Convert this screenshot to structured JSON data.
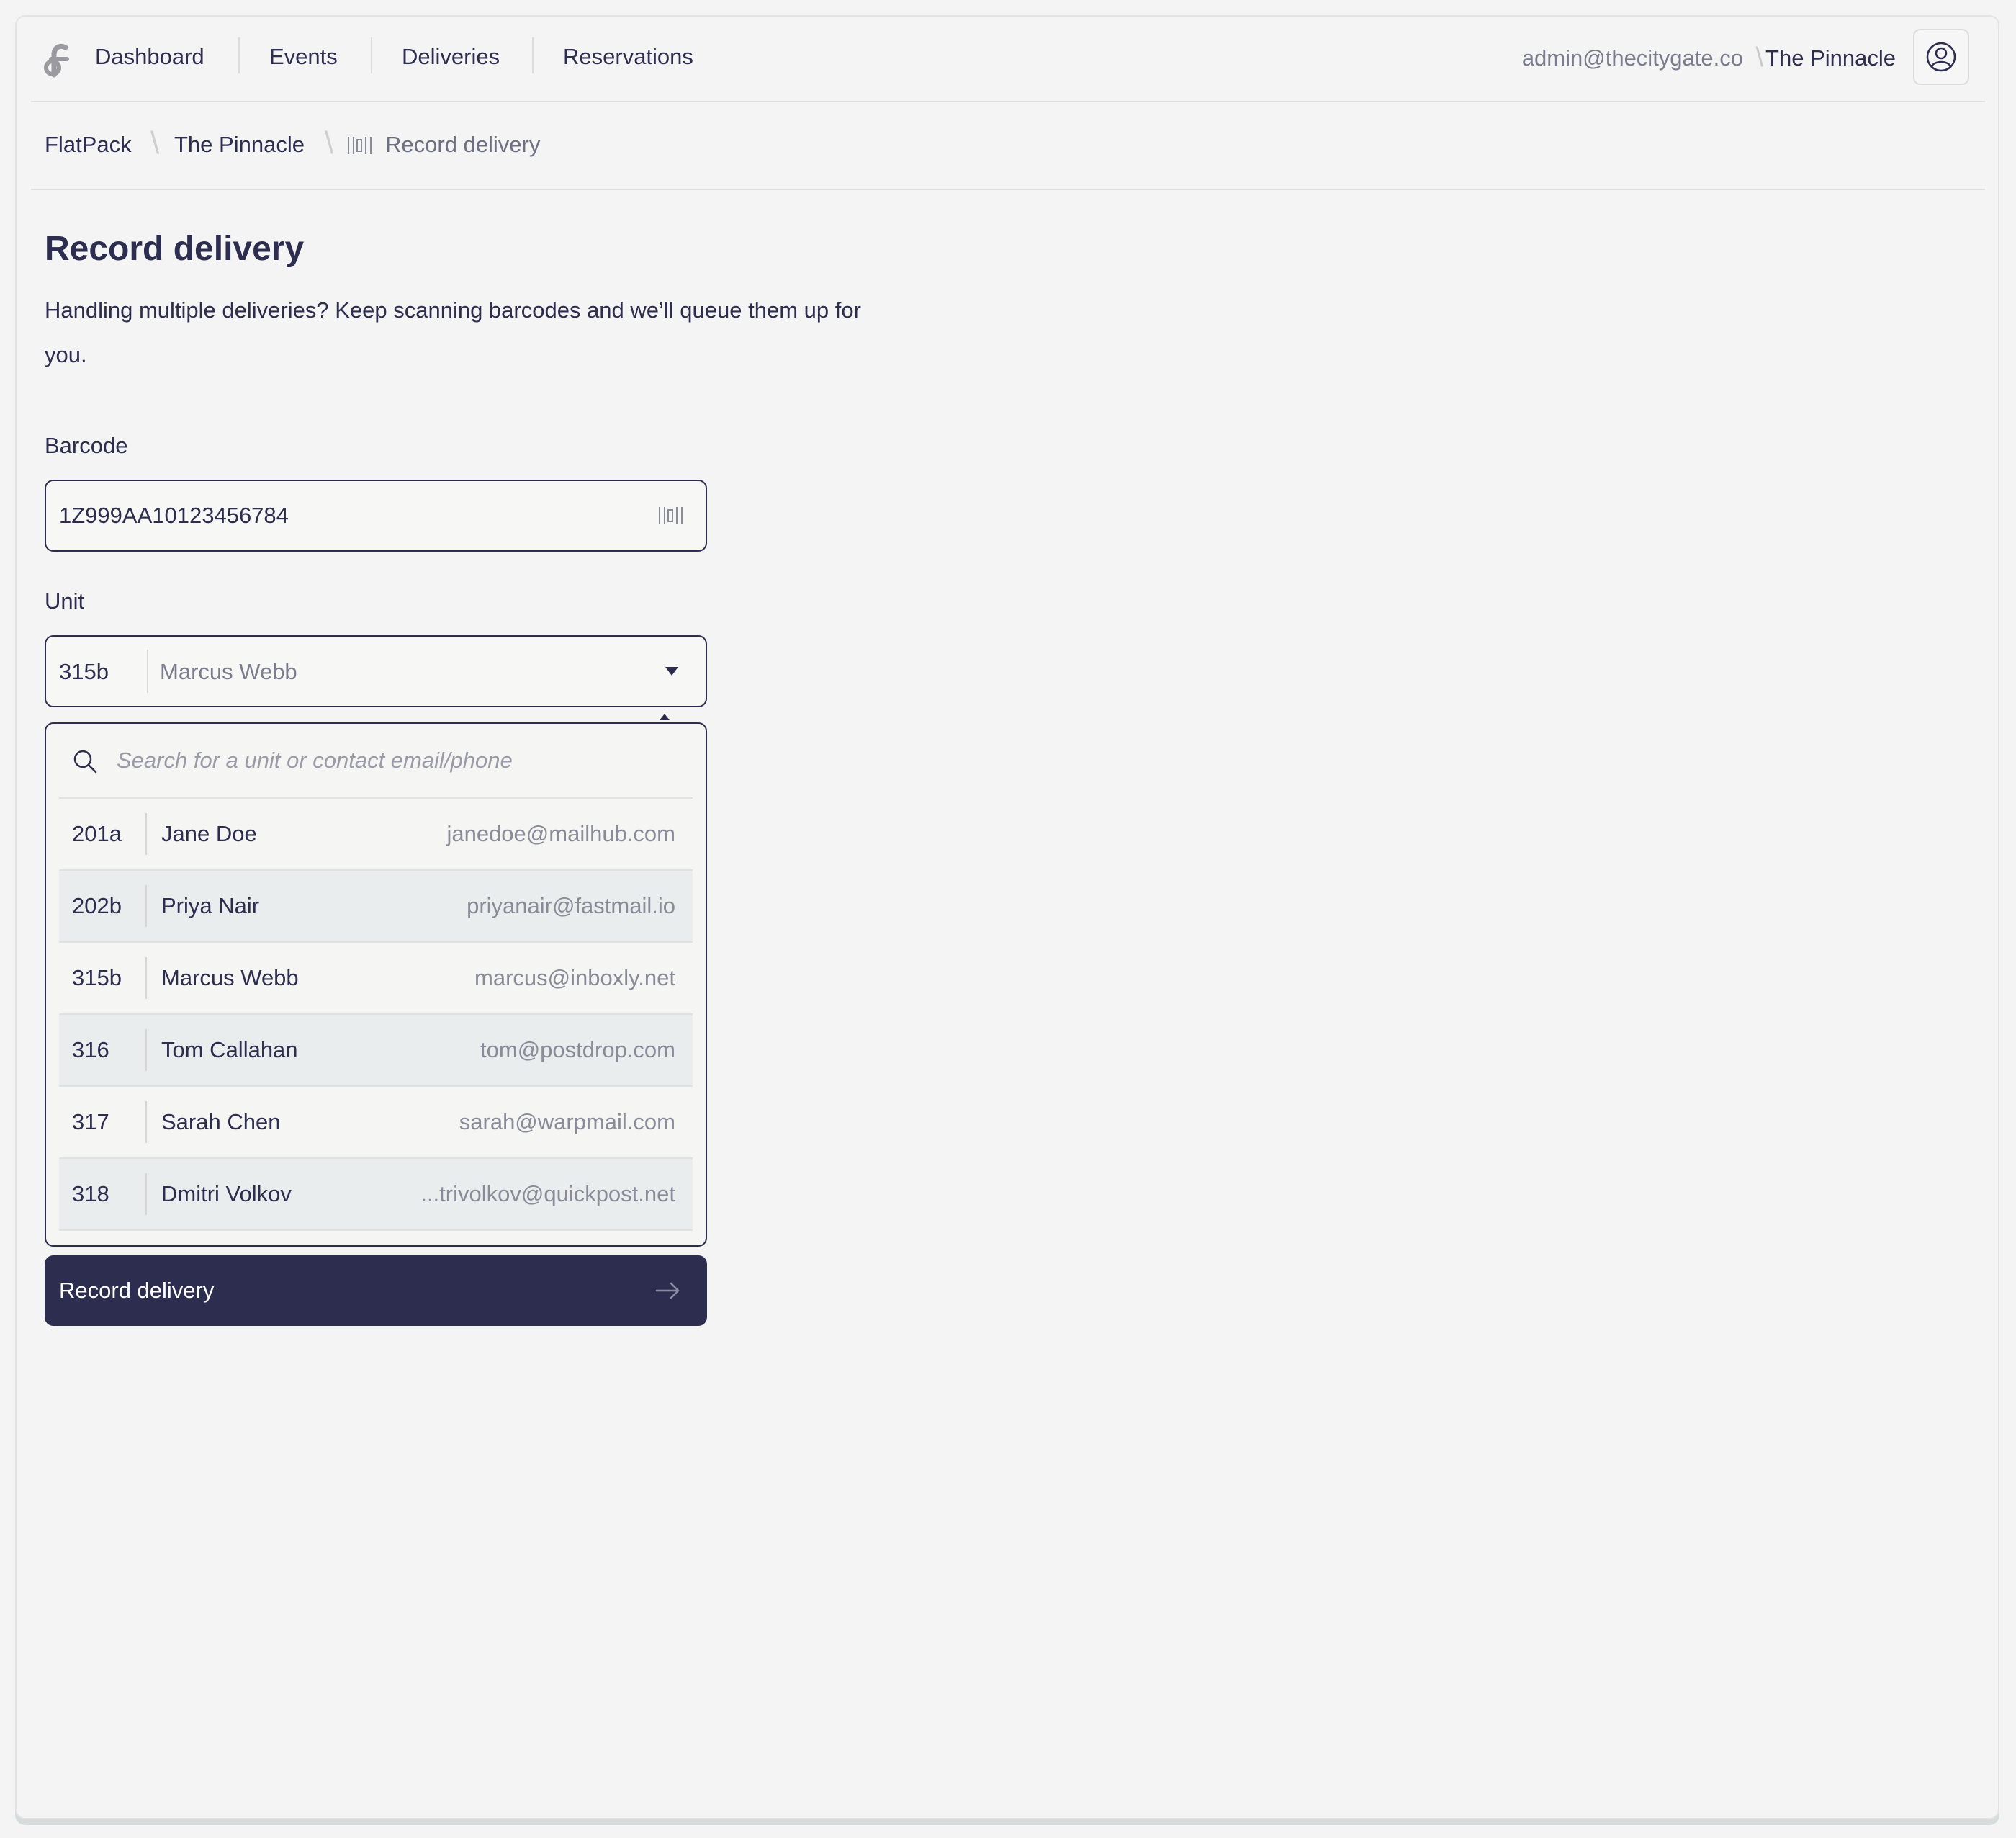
{
  "nav": {
    "items": [
      {
        "label": "Dashboard"
      },
      {
        "label": "Events"
      },
      {
        "label": "Deliveries"
      },
      {
        "label": "Reservations"
      }
    ],
    "account_email": "admin@thecitygate.co",
    "separator": "\\",
    "property_name": "The Pinnacle",
    "logo_icon": "flatpack-logo-icon",
    "avatar_icon": "user-circle-icon"
  },
  "breadcrumb": {
    "items": [
      "FlatPack",
      "The Pinnacle",
      "Record delivery"
    ],
    "current_icon": "barcode-icon"
  },
  "page": {
    "title": "Record delivery",
    "description": "Handling multiple deliveries? Keep scanning barcodes and we’ll queue them up for you."
  },
  "form": {
    "barcode_label": "Barcode",
    "barcode_value": "1Z999AA10123456784",
    "unit_label": "Unit",
    "unit_selected": {
      "unit": "315b",
      "name": "Marcus Webb"
    },
    "search_placeholder": "Search for a unit or contact email/phone",
    "options": [
      {
        "unit": "201a",
        "name": "Jane Doe",
        "email": "janedoe@mailhub.com"
      },
      {
        "unit": "202b",
        "name": "Priya Nair",
        "email": "priyanair@fastmail.io"
      },
      {
        "unit": "315b",
        "name": "Marcus Webb",
        "email": "marcus@inboxly.net"
      },
      {
        "unit": "316",
        "name": "Tom Callahan",
        "email": "tom@postdrop.com"
      },
      {
        "unit": "317",
        "name": "Sarah Chen",
        "email": "sarah@warpmail.com"
      },
      {
        "unit": "318",
        "name": "Dmitri Volkov",
        "email": "...trivolkov@quickpost.net"
      }
    ],
    "submit_label": "Record delivery"
  },
  "colors": {
    "primary": "#2d2e4f",
    "background": "#f4f4f4",
    "muted_text": "#7a7b8c",
    "row_alt": "#eaeded"
  }
}
